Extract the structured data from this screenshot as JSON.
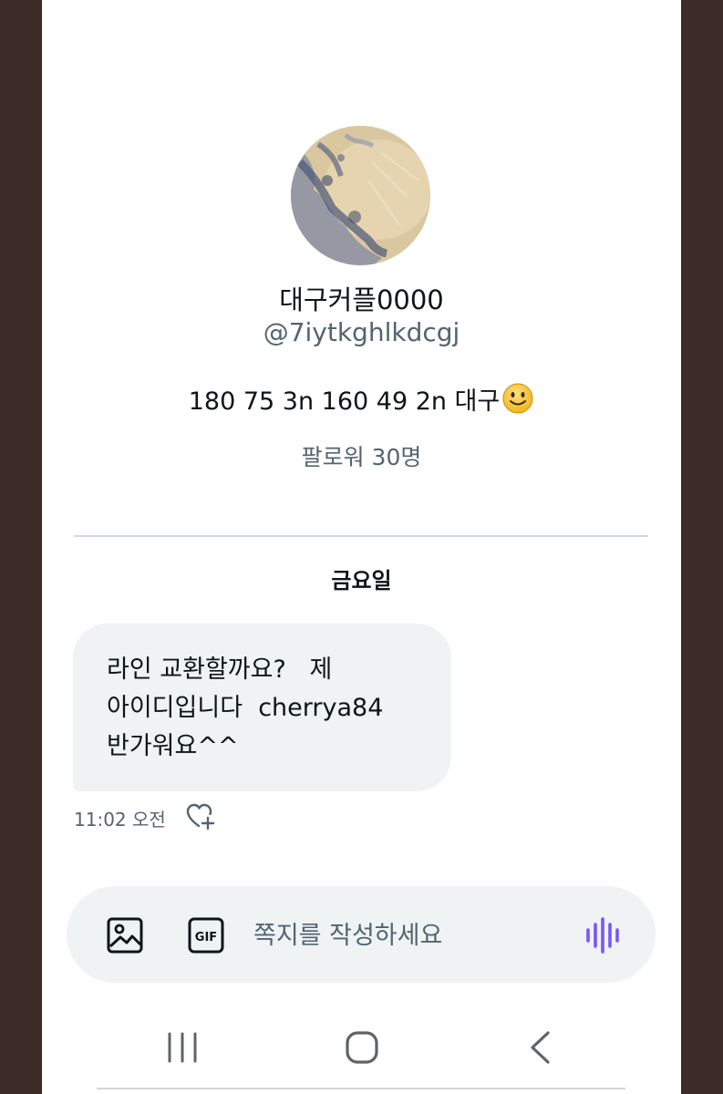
{
  "profile": {
    "display_name": "대구커플0000",
    "handle": "@7iytkghlkdcgj",
    "bio_text": "180 75 3n 160 49 2n 대구",
    "bio_emoji": "slightly-smiling-face",
    "followers": "팔로워 30명"
  },
  "conversation": {
    "day_label": "금요일",
    "messages": [
      {
        "lines": [
          "라인 교환할까요?   제",
          "아이디입니다  cherrya84",
          "반가워요^^"
        ],
        "time": "11:02 오전",
        "reaction_icon": "heart-plus-icon"
      }
    ]
  },
  "composer": {
    "placeholder": "쪽지를 작성하세요",
    "value": "",
    "buttons": [
      "image-icon",
      "gif-icon",
      "voice-wave-icon"
    ]
  },
  "system_nav": {
    "buttons": [
      "recents-icon",
      "home-icon",
      "back-icon"
    ]
  },
  "colors": {
    "background_frame": "#3d2b27",
    "text_primary": "#0f1419",
    "text_secondary": "#536471",
    "bubble": "#eff3f4",
    "voice_accent": "#7856ff"
  }
}
